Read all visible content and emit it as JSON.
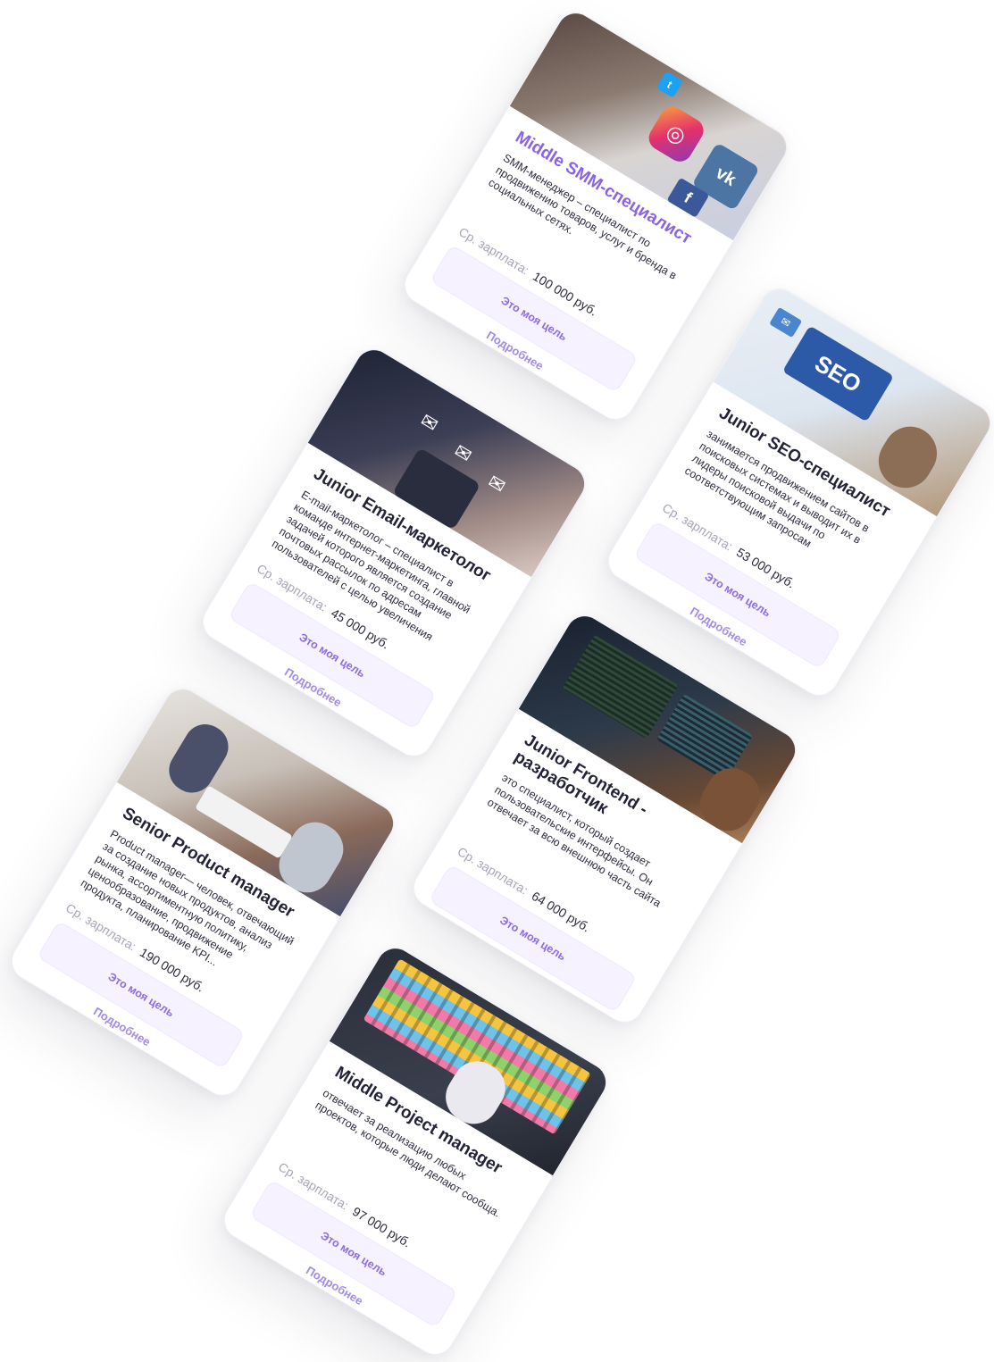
{
  "buttons": {
    "goal_label": "Это моя цель",
    "more_label": "Подробнее"
  },
  "salary_label": "Ср. зарплата:",
  "cards": [
    {
      "title": "Middle SMM-специалист",
      "description": "SMM-менеджер – специалист по продвижению товаров, услуг и бренда в социальных сетях.",
      "salary": "100 000 руб.",
      "image": "social-media-icons-photo"
    },
    {
      "title": "Junior SEO-специалист",
      "description": "занимается продвижением сайтов в поисковых системах и выводит их в лидеры поисковой выдачи по соответствующим запросам",
      "salary": "53 000 руб.",
      "image": "seo-laptop-photo",
      "image_text": "SEO"
    },
    {
      "title": "Junior Email-маркетолог",
      "description": "E-mail-маркетолог – специалист в команде интернет-маркетинга, главной задачей которого является создание почтовых рассылок по адресам пользователей с целью увеличения клиентской базы.",
      "salary": "45 000 руб.",
      "image": "phone-email-photo"
    },
    {
      "title": "Junior Frontend - разработчик",
      "description": "это специалист, который создает пользовательские интерфейсы. Он отвечает за всю внешнюю часть сайта",
      "salary": "64 000 руб.",
      "image": "developer-monitors-photo"
    },
    {
      "title": "Senior Product manager",
      "description": "Product manager— человек, отвечающий за создание новых продуктов, анализ рынка, ассортиментную политику, ценообразование, продвижение продукта, планирование KPI...",
      "salary": "190 000 руб.",
      "image": "team-office-photo"
    },
    {
      "title": "Middle Project manager",
      "description": "отвечает за реализацию любых проектов, которые люди делают сообща.",
      "salary": "97 000 руб.",
      "image": "sticky-notes-board-photo"
    }
  ],
  "colors": {
    "accent": "#8a63e5",
    "button_bg": "#f6f2ff",
    "title": "#232337"
  }
}
